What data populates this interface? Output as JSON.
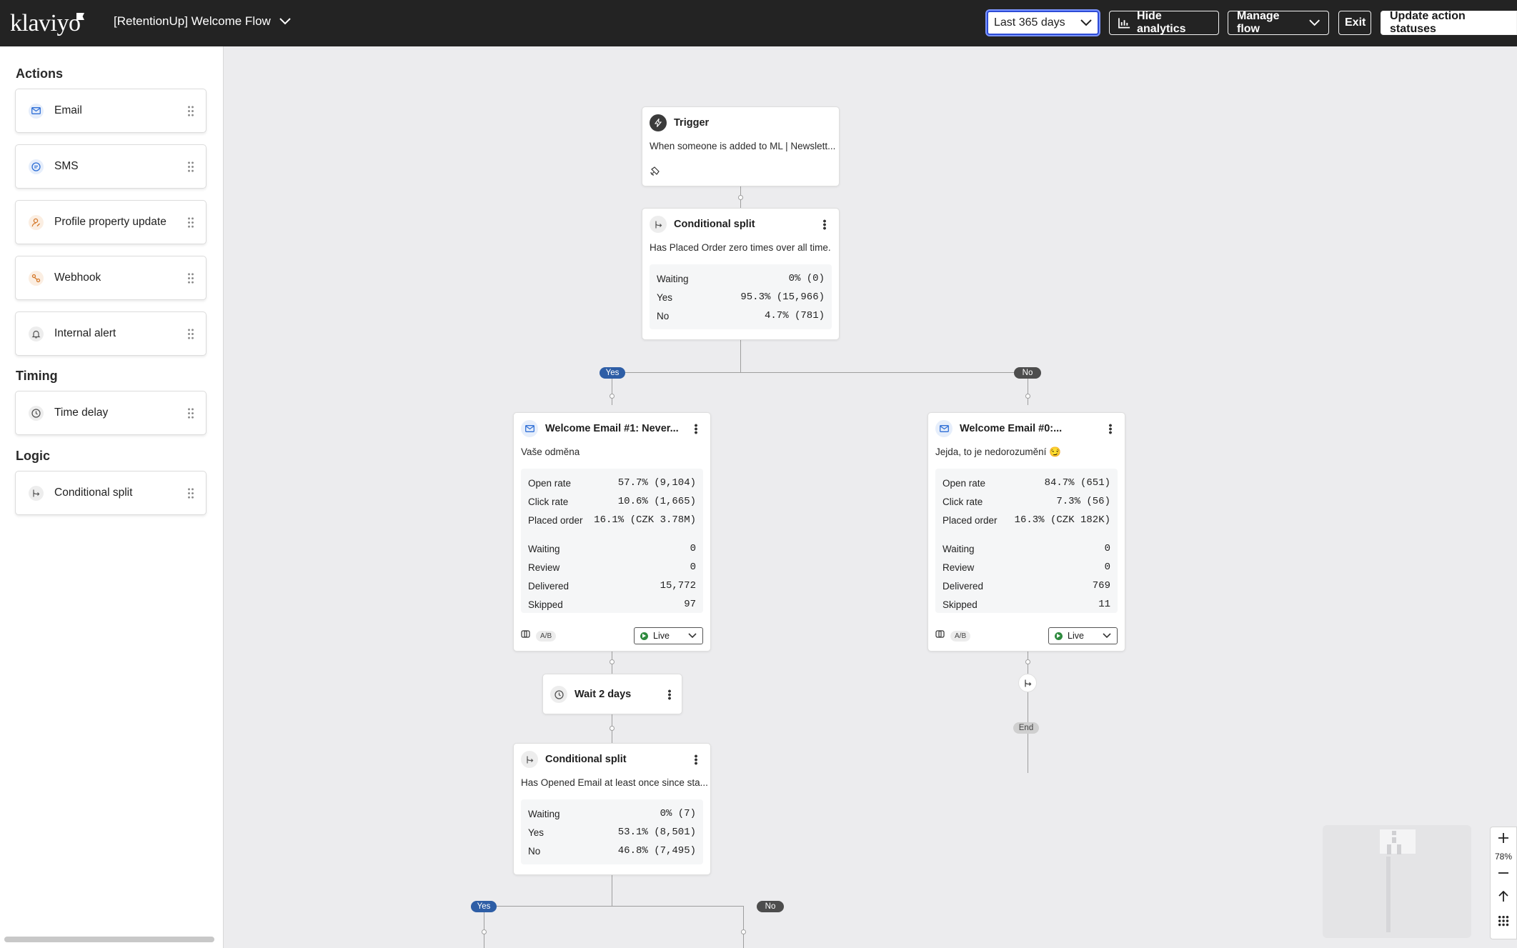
{
  "header": {
    "logo": "klaviyo",
    "flow_title": "[RetentionUp] Welcome Flow",
    "date_range": "Last 365 days",
    "hide_analytics": "Hide analytics",
    "manage_flow": "Manage flow",
    "exit": "Exit",
    "update_statuses": "Update action statuses"
  },
  "sidebar": {
    "actions_title": "Actions",
    "actions": [
      {
        "label": "Email",
        "icon": "mail-icon",
        "color": "#2f6fd6"
      },
      {
        "label": "SMS",
        "icon": "chat-icon",
        "color": "#2f6fd6"
      },
      {
        "label": "Profile property update",
        "icon": "user-edit-icon",
        "color": "#d4782a"
      },
      {
        "label": "Webhook",
        "icon": "webhook-icon",
        "color": "#d4782a"
      },
      {
        "label": "Internal alert",
        "icon": "bell-icon",
        "color": "#555555"
      }
    ],
    "timing_title": "Timing",
    "timing": [
      {
        "label": "Time delay",
        "icon": "clock-icon"
      }
    ],
    "logic_title": "Logic",
    "logic": [
      {
        "label": "Conditional split",
        "icon": "split-icon"
      }
    ]
  },
  "flow": {
    "trigger": {
      "title": "Trigger",
      "desc": "When someone is added to ML | Newslett..."
    },
    "split1": {
      "title": "Conditional split",
      "desc": "Has Placed Order zero times over all time.",
      "stats": [
        {
          "label": "Waiting",
          "value": "0% (0)"
        },
        {
          "label": "Yes",
          "value": "95.3% (15,966)"
        },
        {
          "label": "No",
          "value": "4.7% (781)"
        }
      ]
    },
    "yes_label": "Yes",
    "no_label": "No",
    "email1": {
      "title": "Welcome Email #1: Never...",
      "subject": "Vaše odměna",
      "metrics": [
        {
          "label": "Open rate",
          "value": "57.7% (9,104)"
        },
        {
          "label": "Click rate",
          "value": "10.6% (1,665)"
        },
        {
          "label": "Placed order",
          "value": "16.1% (CZK 3.78M)"
        }
      ],
      "counts": [
        {
          "label": "Waiting",
          "value": "0"
        },
        {
          "label": "Review",
          "value": "0"
        },
        {
          "label": "Delivered",
          "value": "15,772"
        },
        {
          "label": "Skipped",
          "value": "97"
        }
      ],
      "ab": "A/B",
      "status": "Live"
    },
    "email0": {
      "title": "Welcome Email #0:...",
      "subject": "Jejda, to je nedorozumění 😏",
      "metrics": [
        {
          "label": "Open rate",
          "value": "84.7% (651)"
        },
        {
          "label": "Click rate",
          "value": "7.3% (56)"
        },
        {
          "label": "Placed order",
          "value": "16.3% (CZK 182K)"
        }
      ],
      "counts": [
        {
          "label": "Waiting",
          "value": "0"
        },
        {
          "label": "Review",
          "value": "0"
        },
        {
          "label": "Delivered",
          "value": "769"
        },
        {
          "label": "Skipped",
          "value": "11"
        }
      ],
      "ab": "A/B",
      "status": "Live"
    },
    "wait": {
      "title": "Wait 2 days"
    },
    "end_label": "End",
    "split2": {
      "title": "Conditional split",
      "desc": "Has Opened Email at least once since sta...",
      "stats": [
        {
          "label": "Waiting",
          "value": "0% (7)"
        },
        {
          "label": "Yes",
          "value": "53.1% (8,501)"
        },
        {
          "label": "No",
          "value": "46.8% (7,495)"
        }
      ]
    }
  },
  "zoom": {
    "level": "78%"
  }
}
